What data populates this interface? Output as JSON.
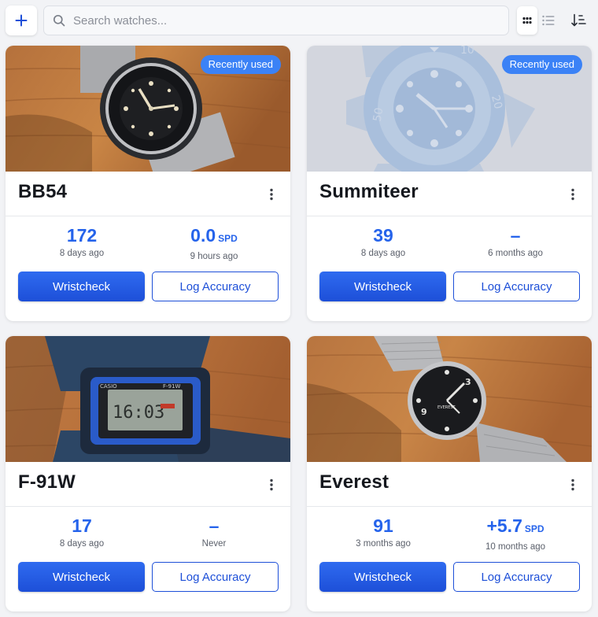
{
  "toolbar": {
    "add_icon": "plus-icon",
    "search_placeholder": "Search watches...",
    "search_value": "",
    "view_modes": [
      "grid",
      "list"
    ],
    "active_view": "grid",
    "sort_icon": "sort-descending-icon"
  },
  "colors": {
    "accent": "#2563eb",
    "badge": "#3b82f6",
    "background": "#f2f3f6"
  },
  "watches": [
    {
      "name": "BB54",
      "badge": "Recently used",
      "photo": "photo",
      "stat_left": {
        "value": "172",
        "unit": "",
        "sub": "8 days ago"
      },
      "stat_right": {
        "value": "0.0",
        "unit": "SPD",
        "sub": "9 hours ago"
      },
      "primary_label": "Wristcheck",
      "secondary_label": "Log Accuracy"
    },
    {
      "name": "Summiteer",
      "badge": "Recently used",
      "photo": "placeholder",
      "stat_left": {
        "value": "39",
        "unit": "",
        "sub": "8 days ago"
      },
      "stat_right": {
        "value": "–",
        "unit": "",
        "sub": "6 months ago"
      },
      "primary_label": "Wristcheck",
      "secondary_label": "Log Accuracy"
    },
    {
      "name": "F-91W",
      "badge": "",
      "photo": "photo",
      "stat_left": {
        "value": "17",
        "unit": "",
        "sub": "8 days ago"
      },
      "stat_right": {
        "value": "–",
        "unit": "",
        "sub": "Never"
      },
      "primary_label": "Wristcheck",
      "secondary_label": "Log Accuracy"
    },
    {
      "name": "Everest",
      "badge": "",
      "photo": "photo",
      "stat_left": {
        "value": "91",
        "unit": "",
        "sub": "3 months ago"
      },
      "stat_right": {
        "value": "+5.7",
        "unit": "SPD",
        "sub": "10 months ago"
      },
      "primary_label": "Wristcheck",
      "secondary_label": "Log Accuracy"
    }
  ]
}
